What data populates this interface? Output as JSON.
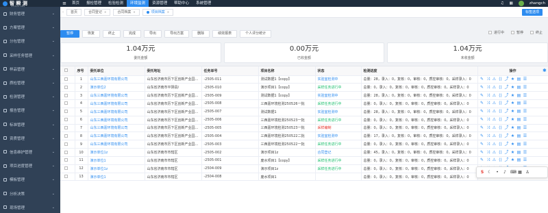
{
  "header": {
    "logo_text": "智 瞬 测",
    "logo_sub": "ZHIXICE LIMS",
    "nav": [
      "首页",
      "报检管理",
      "检验检测",
      "环境监测",
      "资源管理",
      "帮助中心",
      "系统管理"
    ],
    "active_nav": "环境监测",
    "user": "zhangch"
  },
  "sidebar": {
    "items": [
      "财务管理",
      "方案管理",
      "分包管理",
      "采样任务管理",
      "样品管理",
      "质检管理",
      "检测管理",
      "报告管理",
      "标准管理",
      "资质管理",
      "信息维护管理",
      "项目进度管理",
      "模板管理",
      "分析决策",
      "现场管理"
    ]
  },
  "tabs": {
    "items": [
      {
        "label": "首页",
        "closable": false,
        "active": false
      },
      {
        "label": "合同登记",
        "closable": true,
        "active": false
      },
      {
        "label": "合同档案",
        "closable": true,
        "active": false
      },
      {
        "label": "项目档案",
        "closable": true,
        "active": true
      }
    ],
    "right_button": "标签选项"
  },
  "toolbar": {
    "buttons": [
      "暂停",
      "恢复",
      "终止",
      "完成",
      "导出",
      "导出方案",
      "删除",
      "绩效报表",
      "个人评分统计"
    ],
    "filters": [
      "进行中",
      "暂停",
      "终止"
    ]
  },
  "summary": [
    {
      "amount": "1.04万元",
      "label": "委托金额"
    },
    {
      "amount": "0.00万元",
      "label": "已收金额"
    },
    {
      "amount": "1.04万元",
      "label": "未收金额"
    }
  ],
  "table": {
    "columns": [
      "序号",
      "委托单位",
      "委托地址",
      "任务单号",
      "项目名称",
      "状态",
      "检测进度",
      "操作"
    ],
    "rows": [
      {
        "no": "1",
        "unit": "山东三西嘉环境有限公司",
        "addr": "山东省济南市历下区创新产业园B号楼",
        "code": "-2505-011",
        "name": "测试数据1【copy】",
        "status": "实验室检测中",
        "st": "status-a",
        "progress": "总量：28，录入：0，复核：0，审核：0，质控审核：0，采样录入：0"
      },
      {
        "no": "2",
        "unit": "演示单位2",
        "addr": "山东省济南市平阴县/",
        "code": "-2505-010",
        "name": "演示项目1【copy】",
        "status": "采样任务进行中",
        "st": "status-b",
        "progress": "总量：0，录入：0，复核：0，审核：0，质控审核：0，采样录入：0"
      },
      {
        "no": "3",
        "unit": "山东三西嘉环境有限公司",
        "addr": "山东省济南市历下区创新产业园B号楼",
        "code": "-2505-009",
        "name": "测试数据1【copy】",
        "status": "实验室检测中",
        "st": "status-a",
        "progress": "总量：28，录入：0，复核：0，审核：0，质控审核：0，采样录入：0"
      },
      {
        "no": "4",
        "unit": "山东三西嘉环境有限公司",
        "addr": "山东省济南市历下区创新产业园B号楼",
        "code": "-2505-008",
        "name": "三西嘉环境检测250526一批",
        "status": "采样任务进行中",
        "st": "status-b",
        "progress": "总量：0，录入：0，复核：0，审核：0，质控审核：0，采样录入：0"
      },
      {
        "no": "5",
        "unit": "山东三西嘉环境有限公司",
        "addr": "山东省济南市历下区创新产业园B号楼",
        "code": "-2505-007",
        "name": "测试数据1",
        "status": "实验室检测中",
        "st": "status-a",
        "progress": "总量：28，录入：0，复核：0，审核：0，质控审核：0，采样录入：0"
      },
      {
        "no": "6",
        "unit": "山东三西嘉环境有限公司",
        "addr": "山东省济南市历下区创新产业园B号楼",
        "code": "-2505-006",
        "name": "三西嘉环境检测250523一批",
        "status": "采样任务进行中",
        "st": "status-b",
        "progress": "总量：0，录入：0，复核：0，审核：0，质控审核：0，采样录入：0"
      },
      {
        "no": "7",
        "unit": "山东三西嘉环境有限公司",
        "addr": "山东省济南市历下区创新产业园B号楼",
        "code": "-2505-005",
        "name": "三西嘉环境检测250523一批",
        "status": "采样编制",
        "st": "status-c",
        "progress": "总量：0，录入：0，复核：0，审核：0，质控审核：0，采样录入：0"
      },
      {
        "no": "8",
        "unit": "山东三西嘉环境有限公司",
        "addr": "山东省济南市历下区创新产业园B号楼",
        "code": "-2505-004",
        "name": "三西嘉环境检测250522二批",
        "status": "实验室检测中",
        "st": "status-a",
        "progress": "总量：17，录入：0，复核：0，审核：0，质控审核：0，采样录入：0"
      },
      {
        "no": "9",
        "unit": "山东三西嘉环境有限公司",
        "addr": "山东省济南市历下区创新产业园B号楼",
        "code": "-2505-003",
        "name": "三西嘉环境检测250522一批",
        "status": "采样任务进行中",
        "st": "status-b",
        "progress": "总量：0，录入：0，复核：0，审核：0，质控审核：0，采样录入：0"
      },
      {
        "no": "10",
        "unit": "演示单位1z",
        "addr": "山东省济南市市辖区",
        "code": "-2505-002",
        "name": "演示项目1z",
        "status": "合同登记",
        "st": "status-d",
        "progress": "总量：45，录入：0，复核：0，审核：0，质控审核：0，采样录入：0"
      },
      {
        "no": "11",
        "unit": "演示单位1",
        "addr": "山东省济南市市辖区",
        "code": "-2505-001",
        "name": "废水项目1【copy】",
        "status": "采样任务进行中",
        "st": "status-b",
        "progress": "总量：0，录入：0，复核：0，审核：0，质控审核：0，采样录入：0"
      },
      {
        "no": "12",
        "unit": "演示单位1z",
        "addr": "山东省济南市市辖区",
        "code": "-2504-009",
        "name": "演示项目1z",
        "status": "采样任务进行中",
        "st": "status-b",
        "progress": "总量：0，录入：0，复核：0，审核：0，质控审核：0，采样录入：0"
      },
      {
        "no": "13",
        "unit": "演示单位1",
        "addr": "山东省济南市市辖区",
        "code": "-2504-008",
        "name": "废水项目1",
        "status": "",
        "st": "status-b",
        "progress": "总量：0，录入：0，复核：0，审核：0，质控审核：0，采样录入：0"
      }
    ]
  },
  "icons": {
    "row_ops": [
      "edit-icon",
      "shuffle-icon",
      "warning-icon",
      "code-icon",
      "share-icon",
      "star-icon",
      "document-icon",
      "list-icon"
    ],
    "float_ops": [
      "sogou-s-icon",
      "moon-icon",
      "dot-icon",
      "mic-icon",
      "keyboard-icon",
      "apps-icon",
      "shirt-icon"
    ]
  },
  "colors": {
    "primary": "#2d8cf0",
    "topbar": "#1f2d3d",
    "sidebar": "#304156",
    "success": "#19be6b",
    "danger": "#e6332a"
  }
}
